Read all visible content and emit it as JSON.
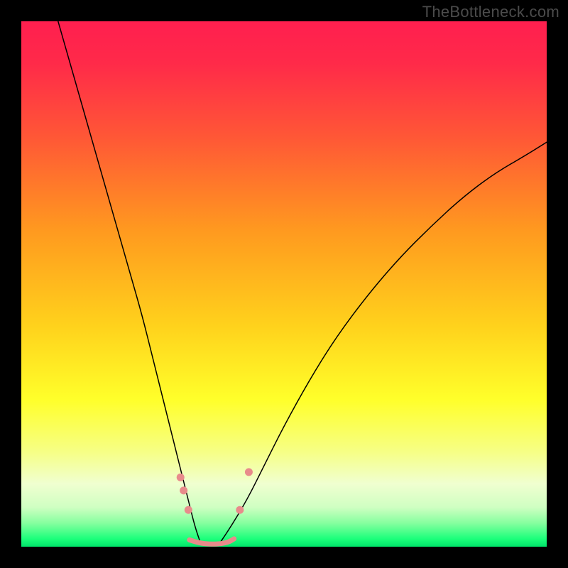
{
  "watermark": "TheBottleneck.com",
  "chart_data": {
    "type": "line",
    "title": "",
    "xlabel": "",
    "ylabel": "",
    "xlim": [
      0,
      100
    ],
    "ylim": [
      0,
      100
    ],
    "grid": false,
    "background_gradient": {
      "stops": [
        {
          "offset": 0.0,
          "color": "#ff1f4f"
        },
        {
          "offset": 0.08,
          "color": "#ff2a49"
        },
        {
          "offset": 0.22,
          "color": "#ff5736"
        },
        {
          "offset": 0.4,
          "color": "#ff9a1f"
        },
        {
          "offset": 0.58,
          "color": "#ffd21c"
        },
        {
          "offset": 0.72,
          "color": "#ffff2a"
        },
        {
          "offset": 0.82,
          "color": "#f6ff86"
        },
        {
          "offset": 0.88,
          "color": "#f0ffd0"
        },
        {
          "offset": 0.925,
          "color": "#cfffc2"
        },
        {
          "offset": 0.955,
          "color": "#86ff9f"
        },
        {
          "offset": 0.985,
          "color": "#1cff7b"
        },
        {
          "offset": 1.0,
          "color": "#00e46a"
        }
      ]
    },
    "series": [
      {
        "name": "left-branch",
        "color": "#000000",
        "stroke_width": 1.5,
        "x": [
          7,
          9,
          11,
          13,
          15,
          17,
          19,
          21,
          23,
          25,
          26.5,
          28,
          29.5,
          31,
          32,
          33,
          34
        ],
        "y": [
          100,
          93,
          86,
          79,
          72,
          65,
          58,
          51,
          44,
          36,
          30,
          24,
          18,
          12,
          8,
          4,
          1
        ]
      },
      {
        "name": "right-branch",
        "color": "#000000",
        "stroke_width": 1.5,
        "x": [
          38,
          40,
          43,
          46,
          50,
          55,
          60,
          66,
          72,
          78,
          84,
          90,
          96,
          100
        ],
        "y": [
          1,
          4,
          9,
          15,
          23,
          32,
          40,
          48,
          55,
          61,
          66.5,
          71,
          74.5,
          77
        ]
      },
      {
        "name": "plateau-line",
        "color": "#e88b8b",
        "stroke_width": 7,
        "x": [
          32,
          33.5,
          35,
          36.5,
          38,
          39.5,
          40.5
        ],
        "y": [
          1.3,
          0.8,
          0.55,
          0.5,
          0.55,
          0.9,
          1.5
        ]
      }
    ],
    "markers": [
      {
        "name": "left-dot-1",
        "x": 30.3,
        "y": 13.2,
        "r": 5.5,
        "color": "#e88b8b"
      },
      {
        "name": "left-dot-2",
        "x": 30.9,
        "y": 10.7,
        "r": 5.5,
        "color": "#e88b8b"
      },
      {
        "name": "left-dot-3",
        "x": 31.8,
        "y": 7.0,
        "r": 5.5,
        "color": "#e88b8b"
      },
      {
        "name": "right-dot-1",
        "x": 41.6,
        "y": 7.0,
        "r": 5.5,
        "color": "#e88b8b"
      },
      {
        "name": "right-dot-2",
        "x": 43.3,
        "y": 14.2,
        "r": 5.5,
        "color": "#e88b8b"
      }
    ]
  }
}
